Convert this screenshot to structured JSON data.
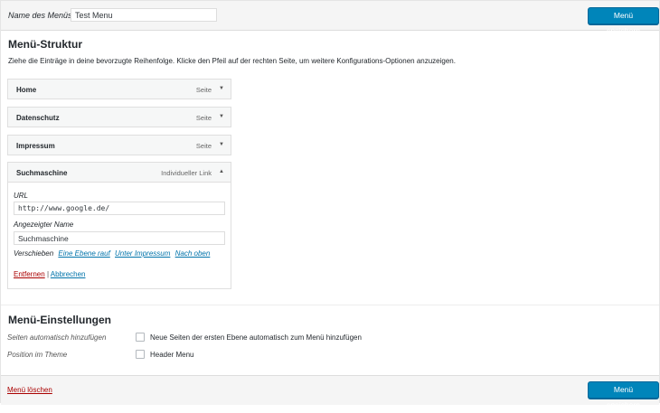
{
  "header": {
    "menu_name_label": "Name des Menüs",
    "menu_name_value": "Test Menu",
    "save_label": "Menü speichern"
  },
  "structure": {
    "title": "Menü-Struktur",
    "instructions": "Ziehe die Einträge in deine bevorzugte Reihenfolge. Klicke den Pfeil auf der rechten Seite, um weitere Konfigurations-Optionen anzuzeigen.",
    "items": [
      {
        "title": "Home",
        "type": "Seite",
        "arrow": "▼"
      },
      {
        "title": "Datenschutz",
        "type": "Seite",
        "arrow": "▼"
      },
      {
        "title": "Impressum",
        "type": "Seite",
        "arrow": "▼"
      },
      {
        "title": "Suchmaschine",
        "type": "Individueller Link",
        "arrow": "▲"
      }
    ],
    "expanded": {
      "url_label": "URL",
      "url_value": "http://www.google.de/",
      "name_label": "Angezeigter Name",
      "name_value": "Suchmaschine",
      "move_label": "Verschieben",
      "move_up": "Eine Ebene rauf",
      "move_under": "Unter Impressum",
      "move_top": "Nach oben",
      "remove_label": "Entfernen",
      "separator": "|",
      "cancel_label": "Abbrechen"
    }
  },
  "settings": {
    "title": "Menü-Einstellungen",
    "auto_add_label": "Seiten automatisch hinzufügen",
    "auto_add_option": "Neue Seiten der ersten Ebene automatisch zum Menü hinzufügen",
    "position_label": "Position im Theme",
    "position_option": "Header Menu"
  },
  "footer": {
    "delete_label": "Menü löschen",
    "save_label": "Menü speichern"
  },
  "colors": {
    "primary_button": "#0085ba",
    "link": "#0073aa",
    "delete": "#aa0000"
  }
}
